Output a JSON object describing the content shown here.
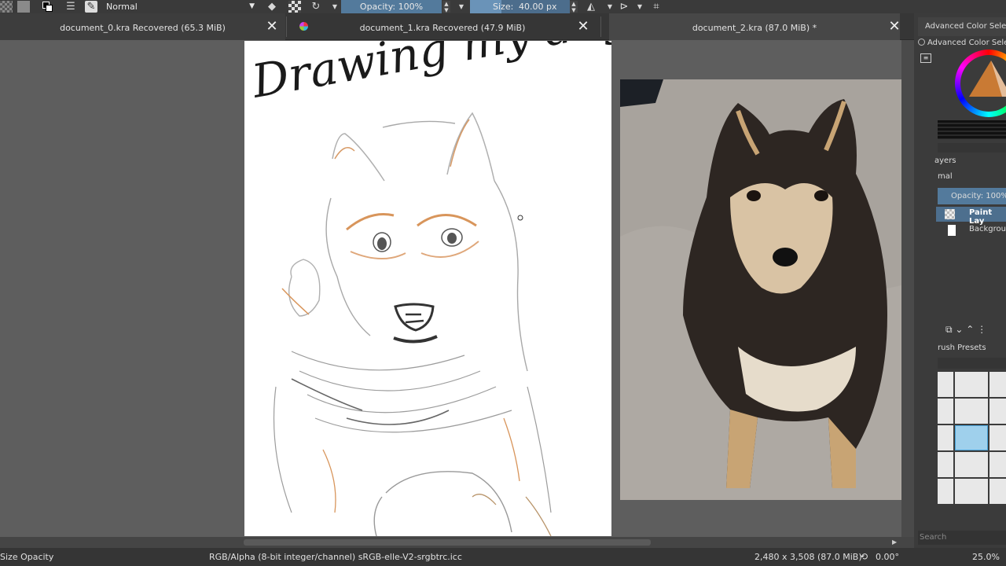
{
  "toolbar": {
    "blend_mode": "Normal",
    "opacity": "Opacity: 100%",
    "size_label": "Size:",
    "size_value": "40.00 px"
  },
  "tabs": [
    {
      "label": "document_0.kra Recovered (65.3 MiB)"
    },
    {
      "label": "document_1.kra Recovered (47.9 MiB)"
    },
    {
      "label": "document_2.kra (87.0 MiB) *"
    }
  ],
  "canvas": {
    "handwritten_title": "Drawing my dog!"
  },
  "docker": {
    "color_tab": "Advanced Color Sele...",
    "color_title": "Advanced Color Sele",
    "layers_title": "ayers",
    "blend": "mal",
    "layer_opacity": "Opacity:  100%",
    "layers": [
      {
        "name": "Paint Lay"
      },
      {
        "name": "Backgrou"
      }
    ],
    "brush_presets": "rush Presets",
    "search_placeholder": "Search"
  },
  "status": {
    "tool": "Size Opacity",
    "color_space": "RGB/Alpha (8-bit integer/channel)  sRGB-elle-V2-srgbtrc.icc",
    "dimensions": "2,480 x 3,508 (87.0 MiB)",
    "rotation": "0.00°",
    "zoom": "25.0%"
  }
}
